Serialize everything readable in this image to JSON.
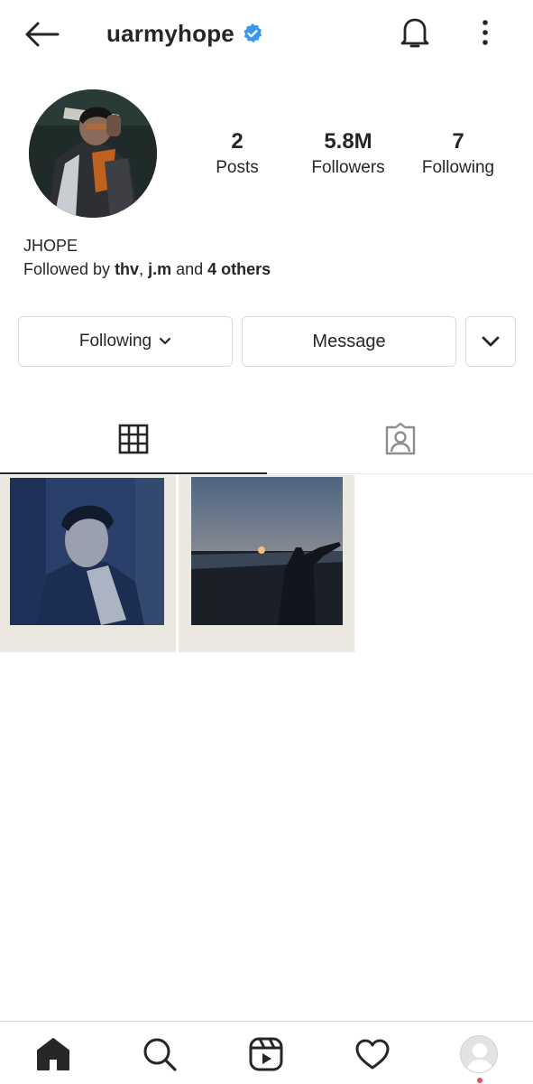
{
  "header": {
    "username": "uarmyhope",
    "verified": true,
    "back_icon": "arrow-left-icon",
    "bell_icon": "bell-icon",
    "more_icon": "vertical-dots-icon"
  },
  "profile": {
    "stats": [
      {
        "value": "2",
        "label": "Posts"
      },
      {
        "value": "5.8M",
        "label": "Followers"
      },
      {
        "value": "7",
        "label": "Following"
      }
    ],
    "name": "JHOPE",
    "followed_by": {
      "prefix": "Followed by ",
      "user1": "thv",
      "separator": ", ",
      "user2": "j.m",
      "conj": " and ",
      "others": "4 others"
    }
  },
  "actions": {
    "following_label": "Following",
    "message_label": "Message"
  },
  "tabs": [
    {
      "name": "grid",
      "icon": "grid-icon",
      "active": true
    },
    {
      "name": "tagged",
      "icon": "tagged-person-icon",
      "active": false
    }
  ],
  "bottom_nav": [
    {
      "name": "home",
      "icon": "home-icon"
    },
    {
      "name": "search",
      "icon": "search-icon"
    },
    {
      "name": "reels",
      "icon": "reels-icon"
    },
    {
      "name": "activity",
      "icon": "heart-icon"
    },
    {
      "name": "profile",
      "icon": "profile-avatar-icon"
    }
  ],
  "colors": {
    "text": "#262626",
    "verified_blue": "#3897f0",
    "border": "#dbdbdb",
    "notification_dot": "#ed4956"
  }
}
